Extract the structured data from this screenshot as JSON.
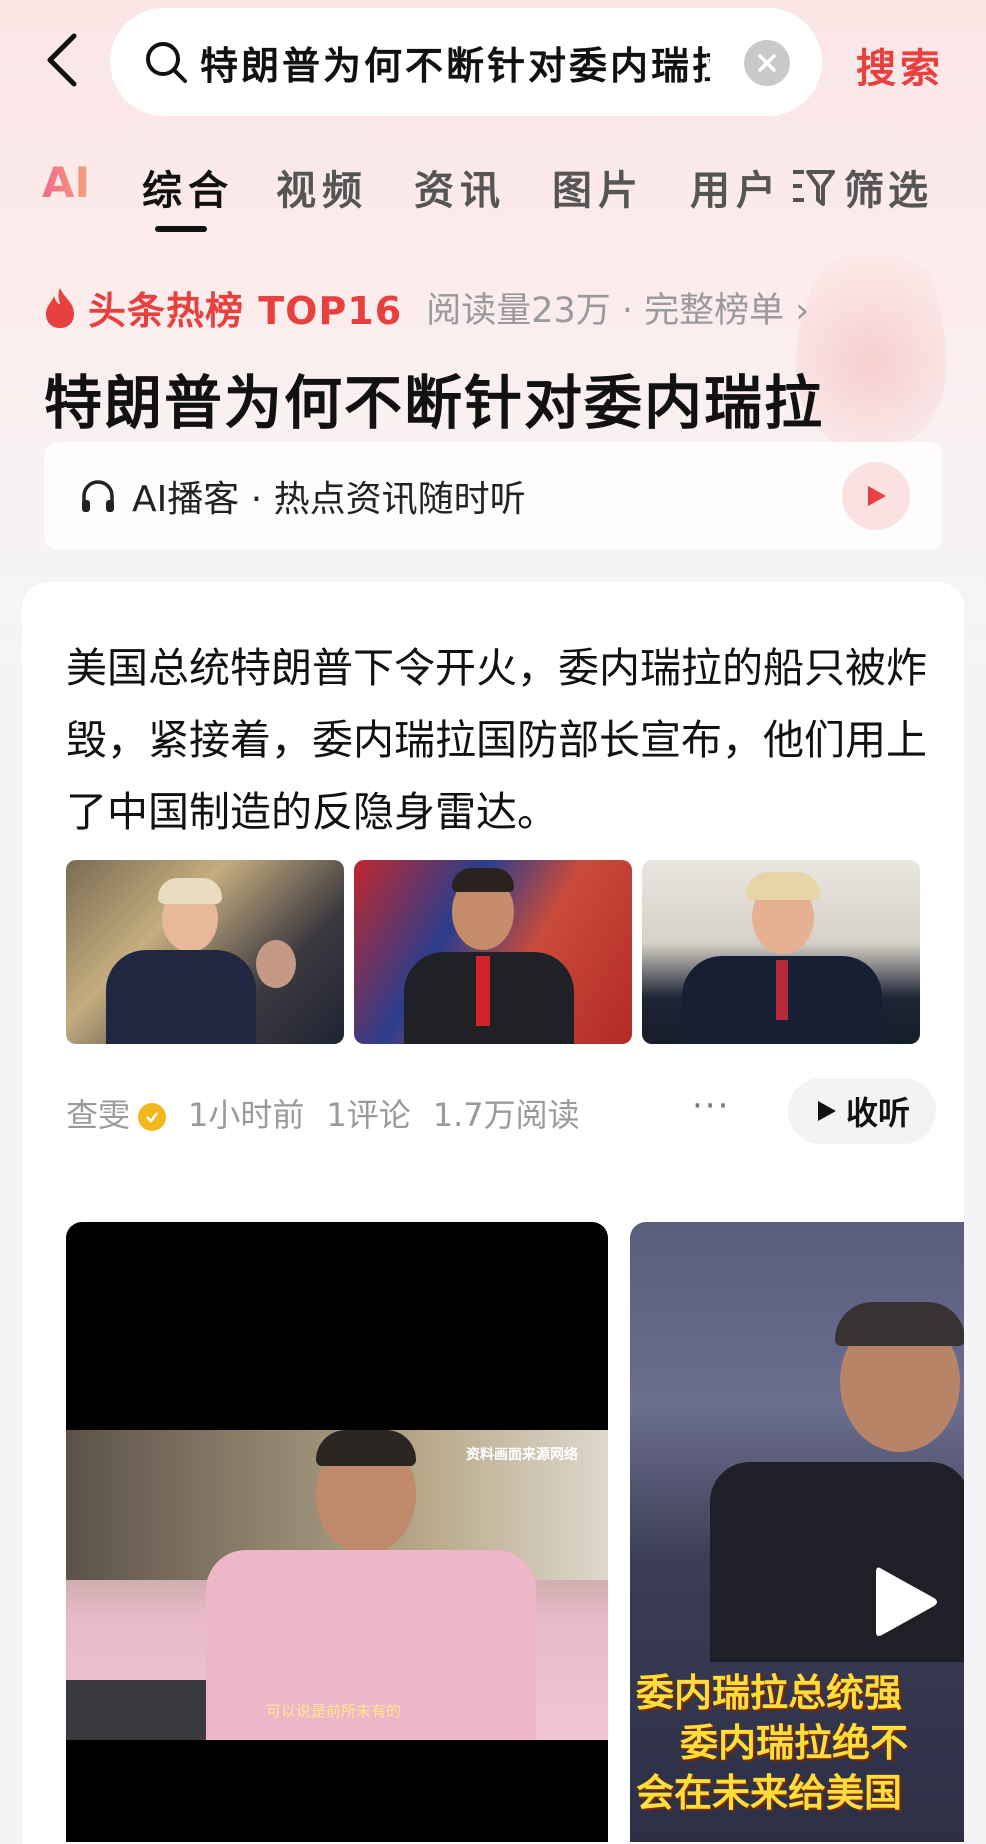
{
  "search": {
    "query": "特朗普为何不断针对委内瑞拉",
    "button_label": "搜索"
  },
  "tabs": {
    "ai_label": "AI",
    "items": [
      "综合",
      "视频",
      "资讯",
      "图片",
      "用户"
    ],
    "active": "综合",
    "filter_label": "筛选"
  },
  "hot": {
    "label": "头条热榜 TOP16",
    "meta": "阅读量23万 · 完整榜单 ›"
  },
  "headline": "特朗普为何不断针对委内瑞拉",
  "podcast": {
    "label": "AI播客 · 热点资讯随时听"
  },
  "article": {
    "text": "美国总统特朗普下令开火，委内瑞拉的船只被炸毁，紧接着，委内瑞拉国防部长宣布，他们用上了中国制造的反隐身雷达。",
    "author": "查雯",
    "time": "1小时前",
    "comments": "1评论",
    "reads": "1.7万阅读",
    "more": "···",
    "listen_label": "收听"
  },
  "videos": {
    "watermark": "资料画面来源网络",
    "subtitle_1": "可以说是前所未有的",
    "subtitle_2_lines": [
      "委内瑞拉总统强",
      "委内瑞拉绝不",
      "会在未来给美国"
    ]
  },
  "colors": {
    "accent": "#e8403f",
    "verified": "#f5b81c"
  }
}
